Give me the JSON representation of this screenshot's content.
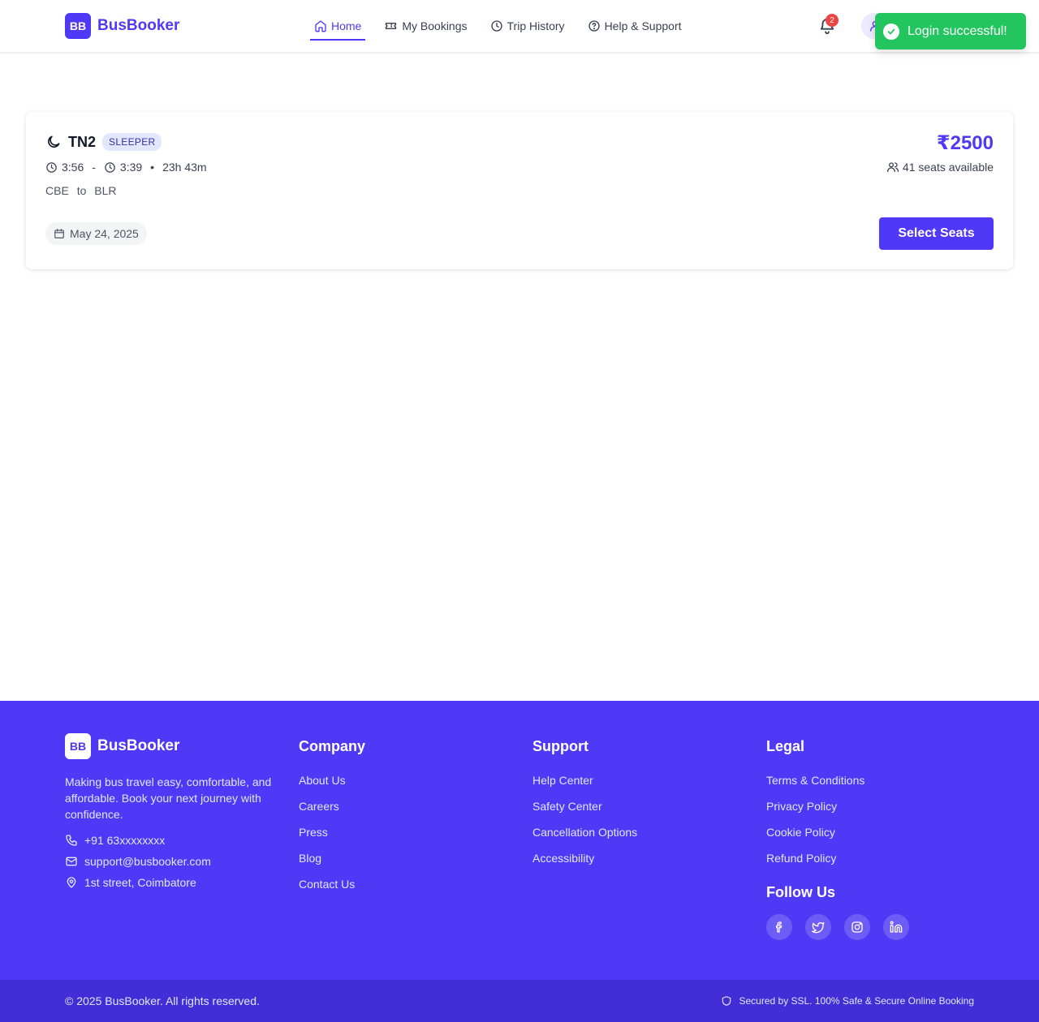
{
  "header": {
    "logo_text": "BB",
    "brand": "BusBooker",
    "nav": [
      {
        "label": "Home",
        "icon": "home-icon",
        "active": true
      },
      {
        "label": "My Bookings",
        "icon": "ticket-icon"
      },
      {
        "label": "Trip History",
        "icon": "clock-icon"
      },
      {
        "label": "Help & Support",
        "icon": "help-circle-icon"
      }
    ],
    "notification_count": "2"
  },
  "toast": {
    "message": "Login successful!"
  },
  "bus": {
    "name": "TN2",
    "type_badge": "SLEEPER",
    "departure": "3:56",
    "dash": "-",
    "arrival": "3:39",
    "dot": "•",
    "duration": "23h 43m",
    "from": "CBE",
    "to_word": "to",
    "to": "BLR",
    "date": "May 24, 2025",
    "price": "₹2500",
    "seats": "41 seats available",
    "select_label": "Select Seats"
  },
  "footer": {
    "logo_text": "BB",
    "brand": "BusBooker",
    "description": "Making bus travel easy, comfortable, and affordable. Book your next journey with confidence.",
    "phone": "+91 63xxxxxxxx",
    "email": "support@busbooker.com",
    "address": "1st street, Coimbatore",
    "company": {
      "heading": "Company",
      "links": [
        "About Us",
        "Careers",
        "Press",
        "Blog",
        "Contact Us"
      ]
    },
    "support": {
      "heading": "Support",
      "links": [
        "Help Center",
        "Safety Center",
        "Cancellation Options",
        "Accessibility"
      ]
    },
    "legal": {
      "heading": "Legal",
      "links": [
        "Terms & Conditions",
        "Privacy Policy",
        "Cookie Policy",
        "Refund Policy"
      ]
    },
    "follow_heading": "Follow Us",
    "socials": [
      "facebook-icon",
      "twitter-icon",
      "instagram-icon",
      "linkedin-icon"
    ],
    "copyright": "© 2025 BusBooker. All rights reserved.",
    "secure": "Secured by SSL. 100% Safe & Secure Online Booking"
  },
  "colors": {
    "accent": "#4f39f6",
    "footer_bottom": "#432dd7",
    "toast": "#22c55e",
    "badge_red": "#ef4444"
  }
}
